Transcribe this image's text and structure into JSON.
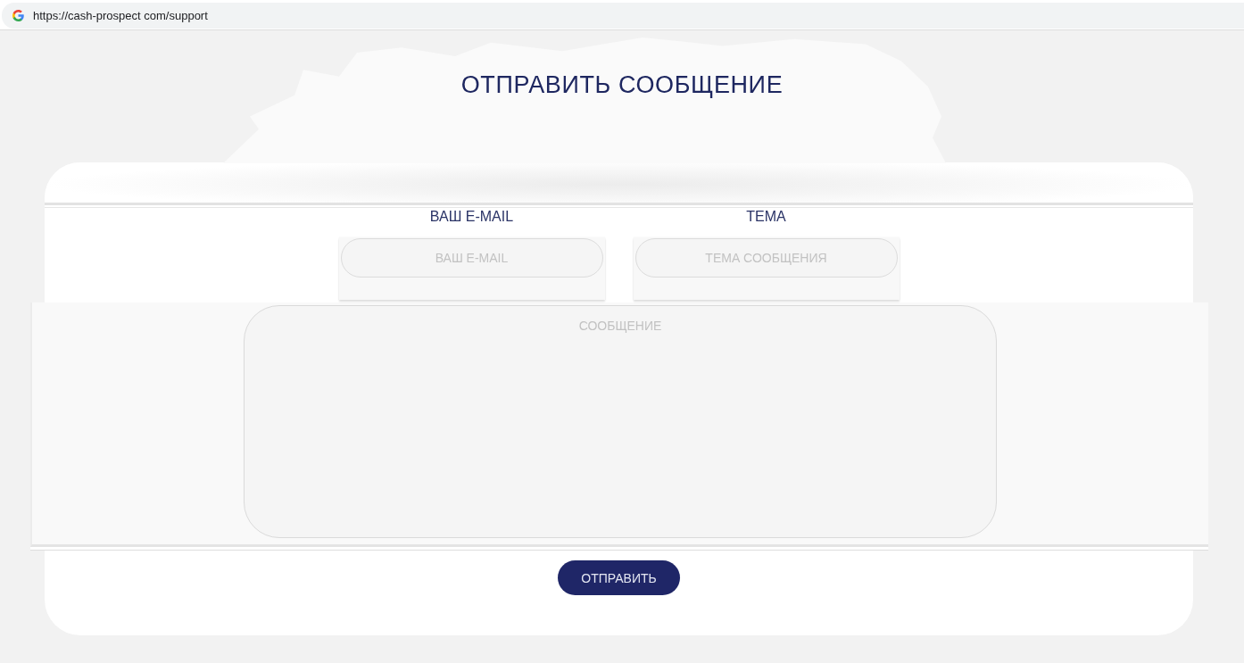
{
  "browser": {
    "url": "https://cash-prospect com/support"
  },
  "title": "ОТПРАВИТЬ СООБЩЕНИЕ",
  "form": {
    "fields": [
      {
        "label": "ВАШ E-MAIL",
        "placeholder": "ВАШ E-MAIL"
      },
      {
        "label": "ТЕМА",
        "placeholder": "ТЕМА СООБЩЕНИЯ"
      }
    ],
    "message": {
      "placeholder": "СООБЩЕНИЕ"
    },
    "submit": "ОТПРАВИТЬ"
  }
}
